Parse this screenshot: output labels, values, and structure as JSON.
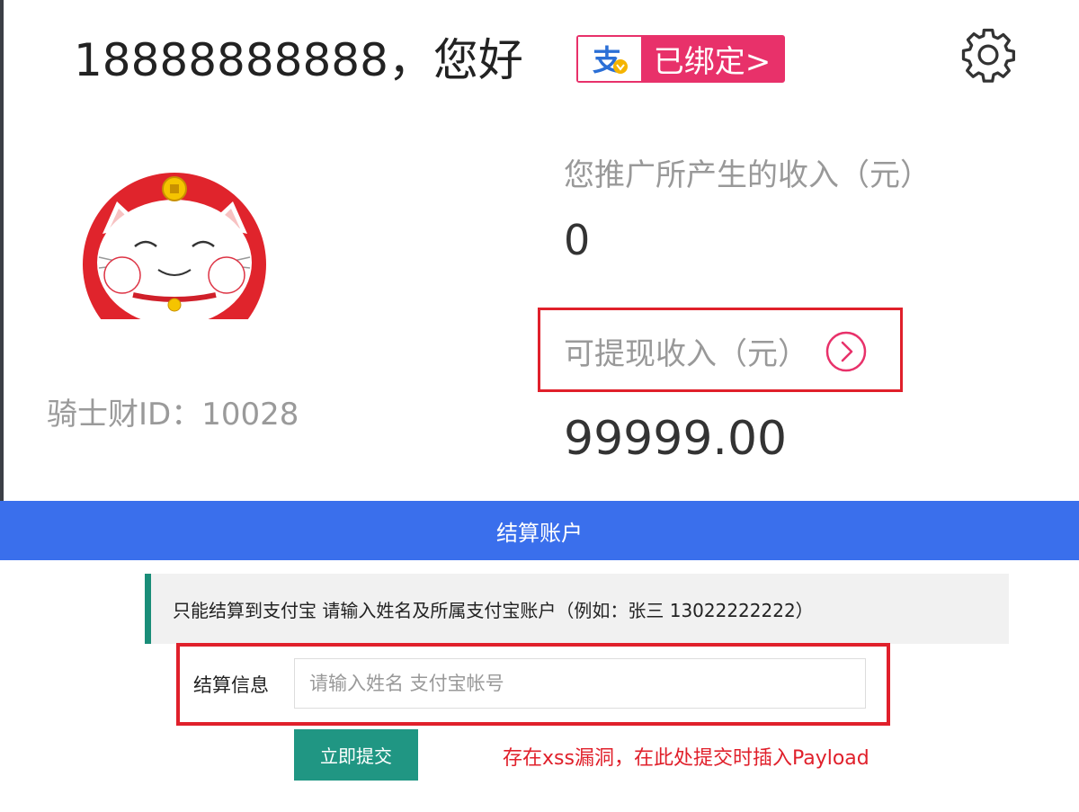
{
  "header": {
    "greeting": "18888888888，您好",
    "alipay_badge_label": "已绑定>",
    "alipay_icon": "alipay-logo-icon",
    "settings_icon": "gear-icon"
  },
  "profile": {
    "avatar_icon": "lucky-cat-avatar",
    "knight_id": "骑士财ID：10028"
  },
  "income": {
    "promo_label": "您推广所产生的收入（元）",
    "promo_value": "0",
    "withdrawable_label": "可提现收入（元）",
    "withdrawable_value": "99999.00",
    "arrow_icon": "chevron-right-circle-icon"
  },
  "settlement": {
    "title": "结算账户",
    "notice": "只能结算到支付宝 请输入姓名及所属支付宝账户（例如：张三 13022222222）",
    "field_label": "结算信息",
    "field_placeholder": "请输入姓名 支付宝帐号",
    "field_value": "",
    "submit_label": "立即提交",
    "annotation": "存在xss漏洞，在此处提交时插入Payload"
  },
  "colors": {
    "header_blue": "#3a6fec",
    "submit_green": "#209683",
    "highlight_red": "#e0202b",
    "badge_pink": "#e8316a"
  }
}
